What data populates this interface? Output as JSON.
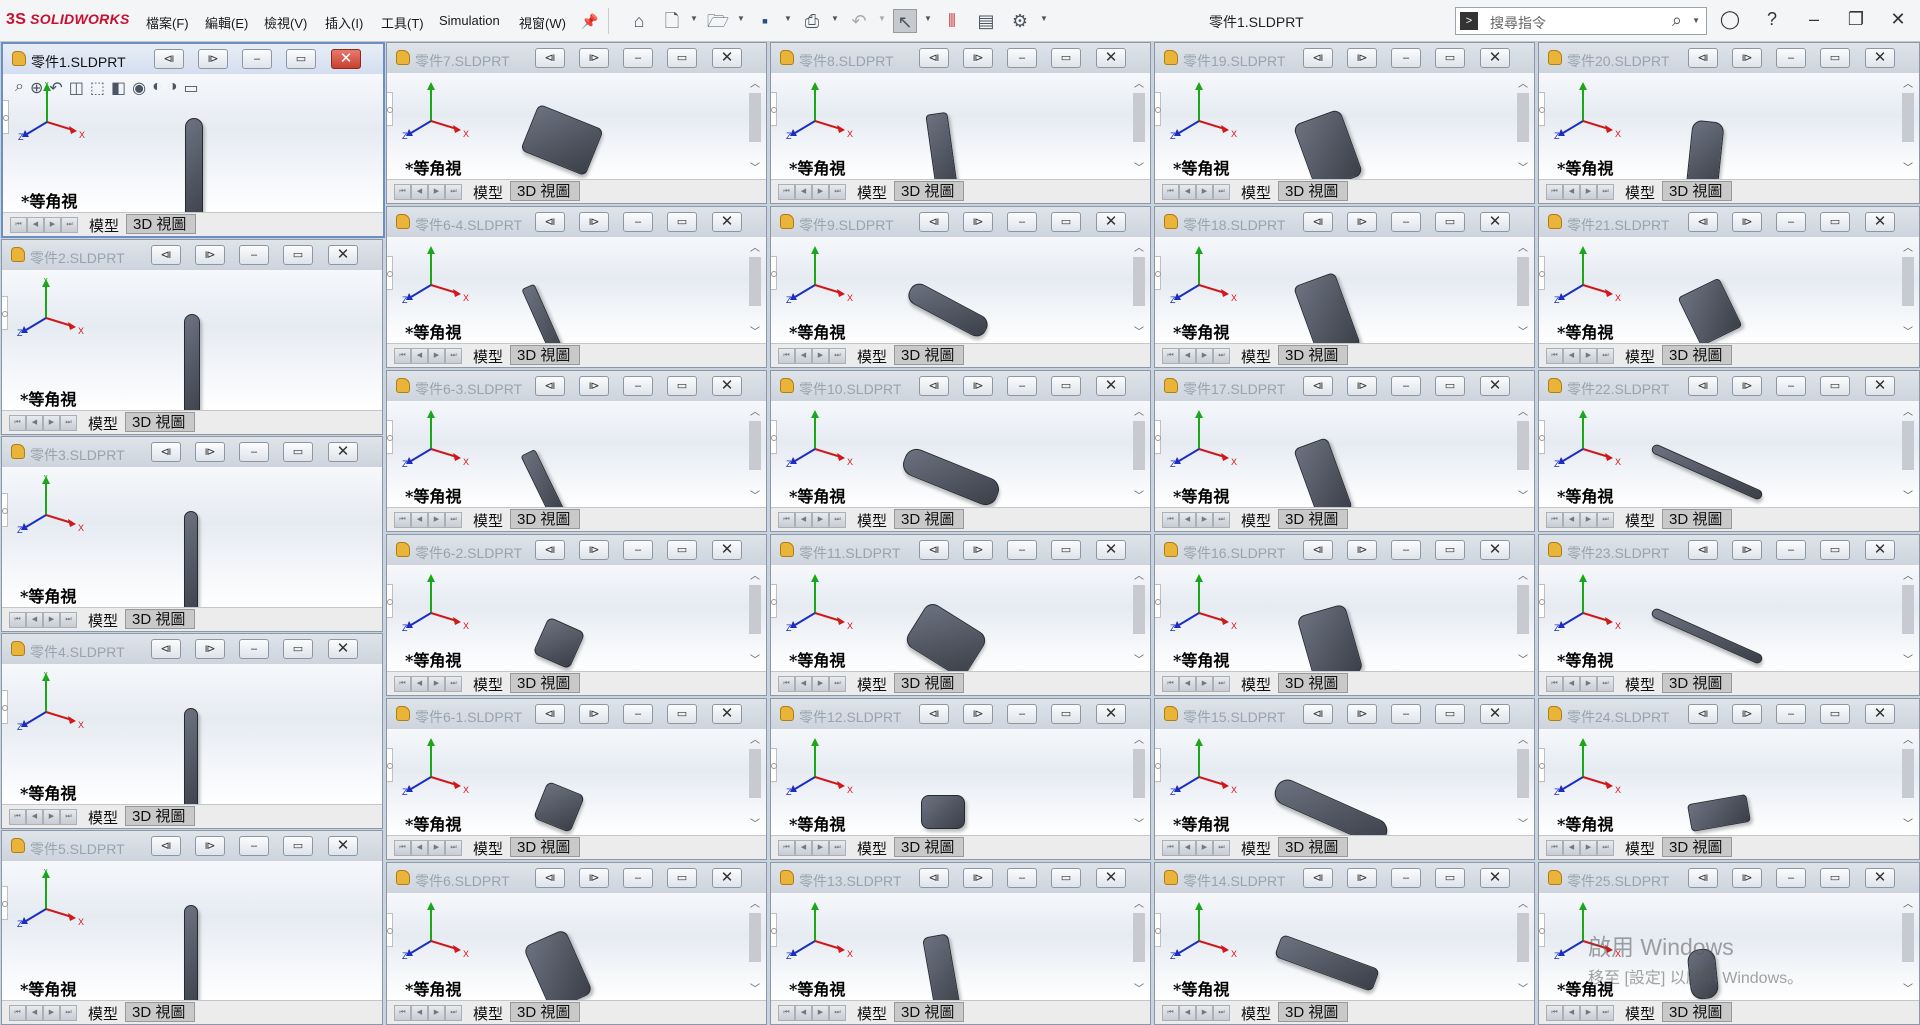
{
  "app": {
    "brand": "SOLIDWORKS",
    "brand_mark": "3S",
    "document_title": "零件1.SLDPRT"
  },
  "menu": [
    "檔案(F)",
    "編輯(E)",
    "檢視(V)",
    "插入(I)",
    "工具(T)",
    "Simulation",
    "視窗(W)"
  ],
  "toolbar_icons": [
    "pin-icon",
    "home-icon",
    "new-document-icon",
    "open-folder-icon",
    "save-icon",
    "print-icon",
    "undo-icon",
    "select-pointer-icon",
    "traffic-light-icon",
    "file-properties-icon",
    "options-gear-icon"
  ],
  "search": {
    "placeholder": "搜尋指令"
  },
  "window_controls": [
    "user-icon",
    "help-icon",
    "restore-icon",
    "close-icon"
  ],
  "view_label": "*等角視",
  "tab_model": "模型",
  "tab_3d": "3D 視圖",
  "axis_labels": {
    "x": "X",
    "y": "Y",
    "z": "Z"
  },
  "doc_windows": [
    {
      "title": "零件1.SLDPRT",
      "active": true
    },
    {
      "title": "零件2.SLDPRT",
      "active": false
    },
    {
      "title": "零件3.SLDPRT",
      "active": false
    },
    {
      "title": "零件4.SLDPRT",
      "active": false
    },
    {
      "title": "零件5.SLDPRT",
      "active": false
    },
    {
      "title": "零件7.SLDPRT",
      "active": false
    },
    {
      "title": "零件6-4.SLDPRT",
      "active": false
    },
    {
      "title": "零件6-3.SLDPRT",
      "active": false
    },
    {
      "title": "零件6-2.SLDPRT",
      "active": false
    },
    {
      "title": "零件6-1.SLDPRT",
      "active": false
    },
    {
      "title": "零件6.SLDPRT",
      "active": false
    },
    {
      "title": "零件8.SLDPRT",
      "active": false
    },
    {
      "title": "零件9.SLDPRT",
      "active": false
    },
    {
      "title": "零件10.SLDPRT",
      "active": false
    },
    {
      "title": "零件11.SLDPRT",
      "active": false
    },
    {
      "title": "零件12.SLDPRT",
      "active": false
    },
    {
      "title": "零件13.SLDPRT",
      "active": false
    },
    {
      "title": "零件19.SLDPRT",
      "active": false
    },
    {
      "title": "零件18.SLDPRT",
      "active": false
    },
    {
      "title": "零件17.SLDPRT",
      "active": false
    },
    {
      "title": "零件16.SLDPRT",
      "active": false
    },
    {
      "title": "零件15.SLDPRT",
      "active": false
    },
    {
      "title": "零件14.SLDPRT",
      "active": false
    },
    {
      "title": "零件20.SLDPRT",
      "active": false
    },
    {
      "title": "零件21.SLDPRT",
      "active": false
    },
    {
      "title": "零件22.SLDPRT",
      "active": false
    },
    {
      "title": "零件23.SLDPRT",
      "active": false
    },
    {
      "title": "零件24.SLDPRT",
      "active": false
    },
    {
      "title": "零件25.SLDPRT",
      "active": false
    }
  ],
  "watermark": {
    "line1": "啟用 Windows",
    "line2": "移至 [設定] 以啟用 Windows。"
  }
}
